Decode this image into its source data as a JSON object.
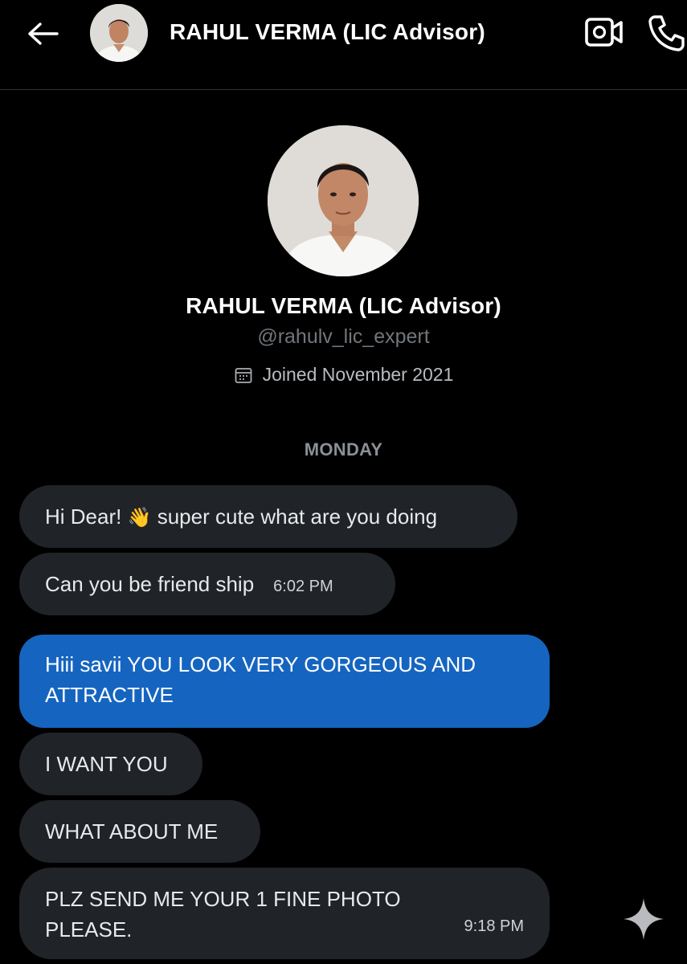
{
  "header": {
    "title": "RAHUL VERMA (LIC Advisor)",
    "back_icon": "arrow-left-icon",
    "video_icon": "video-camera-icon",
    "call_icon": "phone-icon"
  },
  "profile": {
    "name": "RAHUL VERMA (LIC Advisor)",
    "handle": "@rahulv_lic_expert",
    "joined": "Joined November 2021",
    "joined_icon": "calendar-icon"
  },
  "conversation": {
    "day_label": "MONDAY",
    "messages": [
      {
        "direction": "received",
        "text_before_emoji": "Hi Dear!",
        "emoji": "👋",
        "text_after_emoji": "super cute what are you doing"
      },
      {
        "direction": "received",
        "text": "Can you be friend ship",
        "time": "6:02 PM"
      },
      {
        "direction": "sent",
        "text": "Hiii savii YOU LOOK VERY GORGEOUS AND ATTRACTIVE"
      },
      {
        "direction": "received",
        "text": "I WANT YOU"
      },
      {
        "direction": "received",
        "text": "WHAT ABOUT ME"
      },
      {
        "direction": "received",
        "text": "PLZ SEND ME YOUR 1 FINE PHOTO PLEASE.",
        "time": "9:18 PM"
      }
    ]
  },
  "floating": {
    "icon": "sparkle-icon"
  },
  "colors": {
    "background": "#000000",
    "received_bubble": "#202327",
    "sent_bubble": "#1565c0",
    "handle_text": "#71767b"
  }
}
